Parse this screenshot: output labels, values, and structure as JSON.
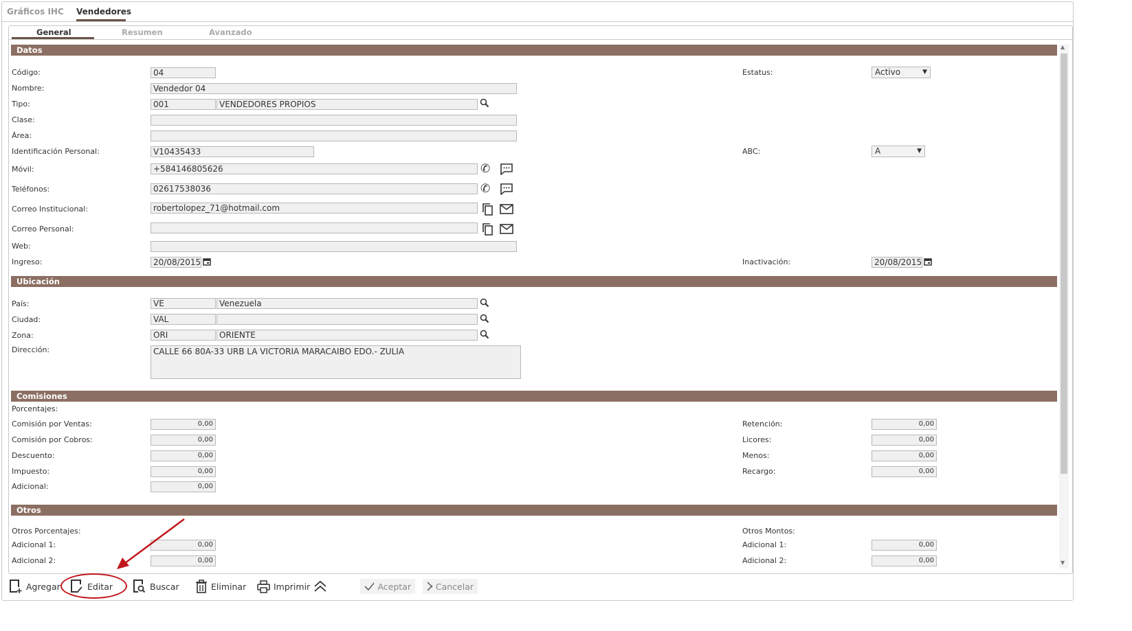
{
  "tabs": {
    "top": [
      "Gráficos IHC",
      "Vendedores"
    ],
    "sub": [
      "General",
      "Resumen",
      "Avanzado"
    ]
  },
  "sections": {
    "datos": "Datos",
    "ubicacion": "Ubicación",
    "comisiones": "Comisiones",
    "otros": "Otros"
  },
  "datos": {
    "codigo": {
      "label": "Código:",
      "value": "04"
    },
    "nombre": {
      "label": "Nombre:",
      "value": "Vendedor 04"
    },
    "tipo": {
      "label": "Tipo:",
      "code": "001",
      "desc": "VENDEDORES PROPIOS"
    },
    "clase": {
      "label": "Clase:",
      "value": ""
    },
    "area": {
      "label": "Área:",
      "value": ""
    },
    "ident": {
      "label": "Identificación Personal:",
      "value": "V10435433"
    },
    "movil": {
      "label": "Móvil:",
      "value": "+584146805626"
    },
    "telefonos": {
      "label": "Teléfonos:",
      "value": "02617538036"
    },
    "correo_inst": {
      "label": "Correo Institucional:",
      "value": "robertolopez_71@hotmail.com"
    },
    "correo_pers": {
      "label": "Correo Personal:",
      "value": ""
    },
    "web": {
      "label": "Web:",
      "value": ""
    },
    "ingreso": {
      "label": "Ingreso:",
      "value": "20/08/2015"
    },
    "estatus": {
      "label": "Estatus:",
      "value": "Activo"
    },
    "abc": {
      "label": "ABC:",
      "value": "A"
    },
    "inactivacion": {
      "label": "Inactivación:",
      "value": "20/08/2015"
    }
  },
  "ubicacion": {
    "pais": {
      "label": "País:",
      "code": "VE",
      "desc": "Venezuela"
    },
    "ciudad": {
      "label": "Ciudad:",
      "code": "VAL",
      "desc": ""
    },
    "zona": {
      "label": "Zona:",
      "code": "ORI",
      "desc": "ORIENTE"
    },
    "direccion": {
      "label": "Dirección:",
      "value": "CALLE 66 80A-33 URB LA VICTORIA MARACAIBO EDO.- ZULIA"
    }
  },
  "comisiones": {
    "porcentajes": "Porcentajes:",
    "left": [
      {
        "label": "Comisión por Ventas:",
        "value": "0,00"
      },
      {
        "label": "Comisión por Cobros:",
        "value": "0,00"
      },
      {
        "label": "Descuento:",
        "value": "0,00"
      },
      {
        "label": "Impuesto:",
        "value": "0,00"
      },
      {
        "label": "Adicional:",
        "value": "0,00"
      }
    ],
    "right": [
      {
        "label": "Retención:",
        "value": "0,00"
      },
      {
        "label": "Licores:",
        "value": "0,00"
      },
      {
        "label": "Menos:",
        "value": "0,00"
      },
      {
        "label": "Recargo:",
        "value": "0,00"
      }
    ]
  },
  "otros": {
    "porcentajes": "Otros Porcentajes:",
    "montos": "Otros Montos:",
    "left": [
      {
        "label": "Adicional 1:",
        "value": "0,00"
      },
      {
        "label": "Adicional 2:",
        "value": "0,00"
      }
    ],
    "right": [
      {
        "label": "Adicional 1:",
        "value": "0,00"
      },
      {
        "label": "Adicional 2:",
        "value": "0,00"
      }
    ]
  },
  "toolbar": {
    "agregar": "Agregar",
    "editar": "Editar",
    "buscar": "Buscar",
    "eliminar": "Eliminar",
    "imprimir": "Imprimir",
    "aceptar": "Aceptar",
    "cancelar": "Cancelar"
  },
  "colors": {
    "section_bar": "#8b6f62",
    "highlight": "#c0161b"
  }
}
